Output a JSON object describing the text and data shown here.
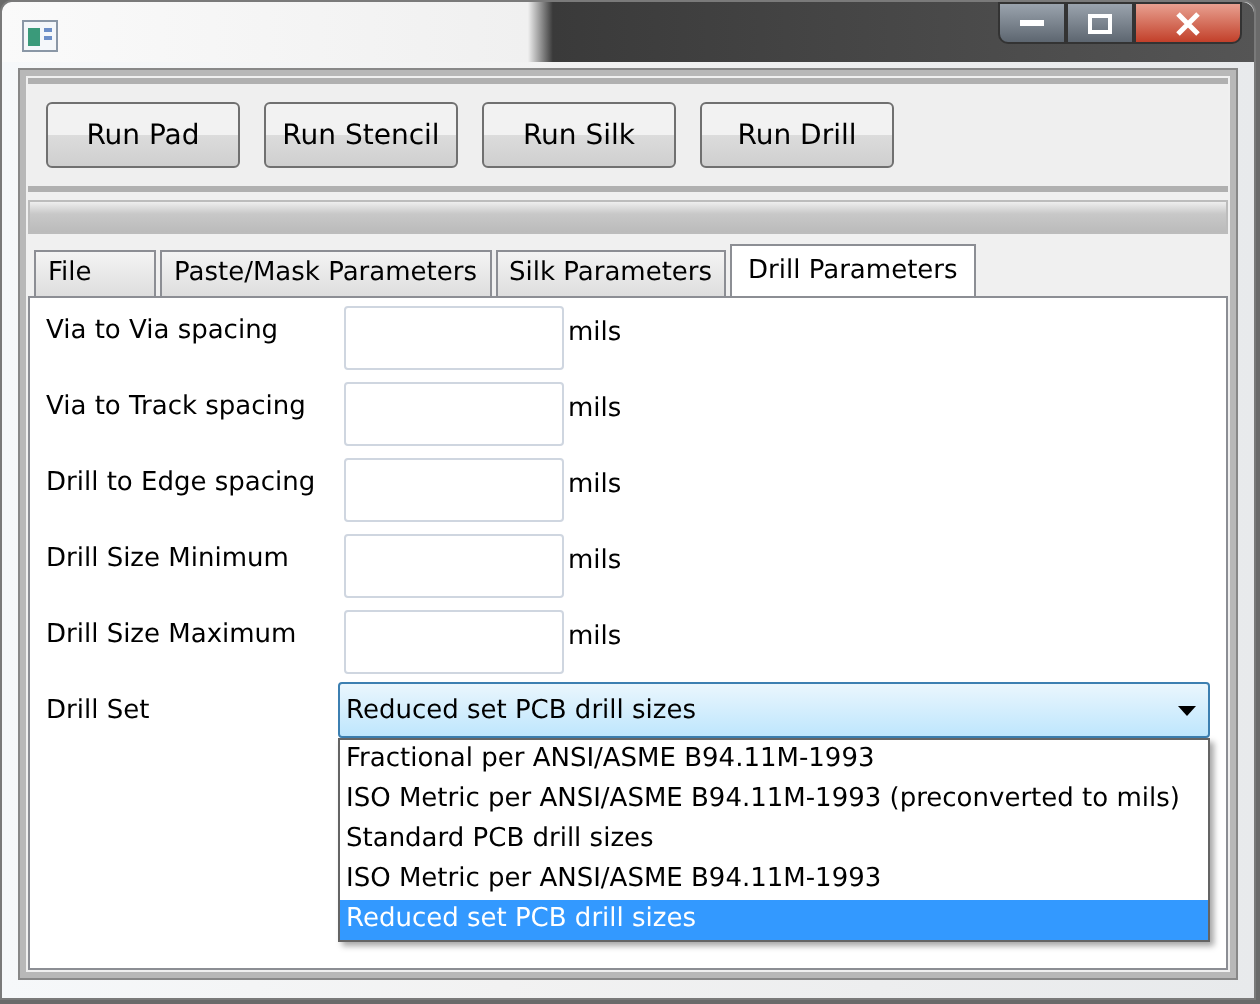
{
  "toolbar": {
    "buttons": [
      "Run Pad",
      "Run Stencil",
      "Run Silk",
      "Run Drill"
    ]
  },
  "progress": {
    "level": 0
  },
  "tabs": [
    {
      "label": "File",
      "selected": false
    },
    {
      "label": "Paste/Mask Parameters",
      "selected": false
    },
    {
      "label": "Silk Parameters",
      "selected": false
    },
    {
      "label": "Drill Parameters",
      "selected": true
    }
  ],
  "fields": [
    {
      "label": "Via to Via spacing",
      "unit": "mils"
    },
    {
      "label": "Via to Track spacing",
      "unit": "mils"
    },
    {
      "label": "Drill to Edge spacing",
      "unit": "mils"
    },
    {
      "label": "Drill Size Minimum",
      "unit": "mils"
    },
    {
      "label": "Drill Size Maximum",
      "unit": "mils"
    }
  ],
  "drill_set": {
    "label": "Drill Set",
    "value": "Reduced set PCB drill sizes",
    "expanded": true,
    "options": [
      {
        "label": "Fractional per ANSI/ASME B94.11M-1993",
        "selected": false
      },
      {
        "label": "ISO Metric per ANSI/ASME B94.11M-1993 (preconverted to mils)",
        "selected": false
      },
      {
        "label": "Standard PCB drill sizes",
        "selected": false
      },
      {
        "label": "ISO Metric per ANSI/ASME B94.11M-1993",
        "selected": false
      },
      {
        "label": "Reduced set PCB drill sizes",
        "selected": true
      }
    ]
  }
}
